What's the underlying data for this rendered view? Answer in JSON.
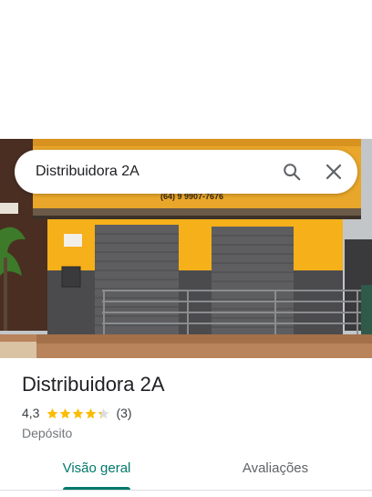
{
  "search": {
    "query": "Distribuidora 2A"
  },
  "photo": {
    "phone_text": "(64) 9 9907-7676"
  },
  "place": {
    "name": "Distribuidora 2A",
    "rating": "4,3",
    "stars": 4.3,
    "review_count": "(3)",
    "category": "Depósito"
  },
  "tabs": [
    {
      "label": "Visão geral",
      "selected": true
    },
    {
      "label": "Avaliações",
      "selected": false
    }
  ],
  "colors": {
    "accent": "#00796b",
    "star": "#fbbc04",
    "star_empty": "#dadce0"
  },
  "icons": {
    "search": "search-icon",
    "close": "close-icon"
  }
}
